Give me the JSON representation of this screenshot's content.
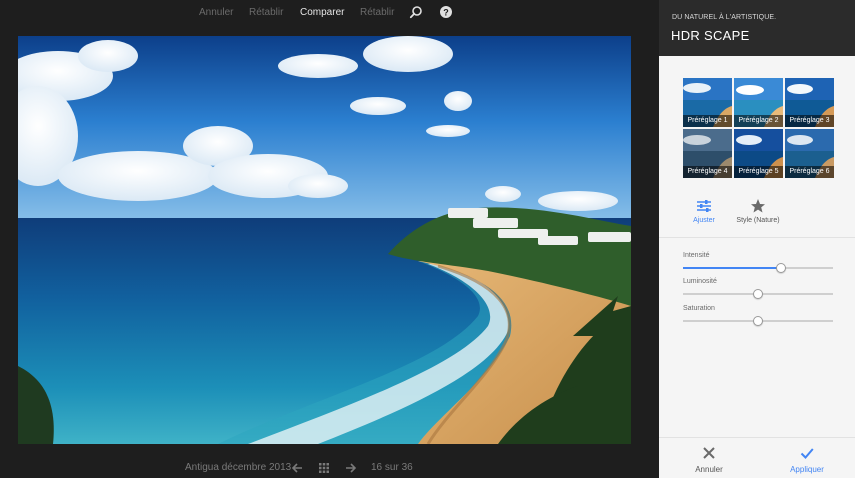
{
  "toolbar": {
    "undo": "Annuler",
    "redo": "Rétablir",
    "compare": "Comparer",
    "restore": "Rétablir",
    "zoom_icon": "magnifier-icon",
    "help_icon": "help-icon"
  },
  "bottom_bar": {
    "album": "Antigua décembre 2013",
    "prev_icon": "arrow-left-icon",
    "grid_icon": "grid-icon",
    "next_icon": "arrow-right-icon",
    "counter": "16 sur 36"
  },
  "panel": {
    "subtitle": "DU NATUREL À L'ARTISTIQUE.",
    "title": "HDR SCAPE",
    "presets": [
      {
        "label": "Préréglage 1"
      },
      {
        "label": "Préréglage 2"
      },
      {
        "label": "Préréglage 3"
      },
      {
        "label": "Préréglage 4"
      },
      {
        "label": "Préréglage 5"
      },
      {
        "label": "Préréglage 6"
      }
    ],
    "modes": {
      "adjust": "Ajuster",
      "style": "Style (Nature)"
    },
    "sliders": [
      {
        "label": "Intensité",
        "value": 0.65
      },
      {
        "label": "Luminosité",
        "value": 0.5
      },
      {
        "label": "Saturation",
        "value": 0.5
      }
    ],
    "footer": {
      "cancel": "Annuler",
      "apply": "Appliquer"
    }
  },
  "colors": {
    "accent": "#4285f4",
    "panel_header": "#2b2b2b",
    "panel_bg": "#f5f5f5",
    "editor_bg": "#1e1e1e"
  }
}
